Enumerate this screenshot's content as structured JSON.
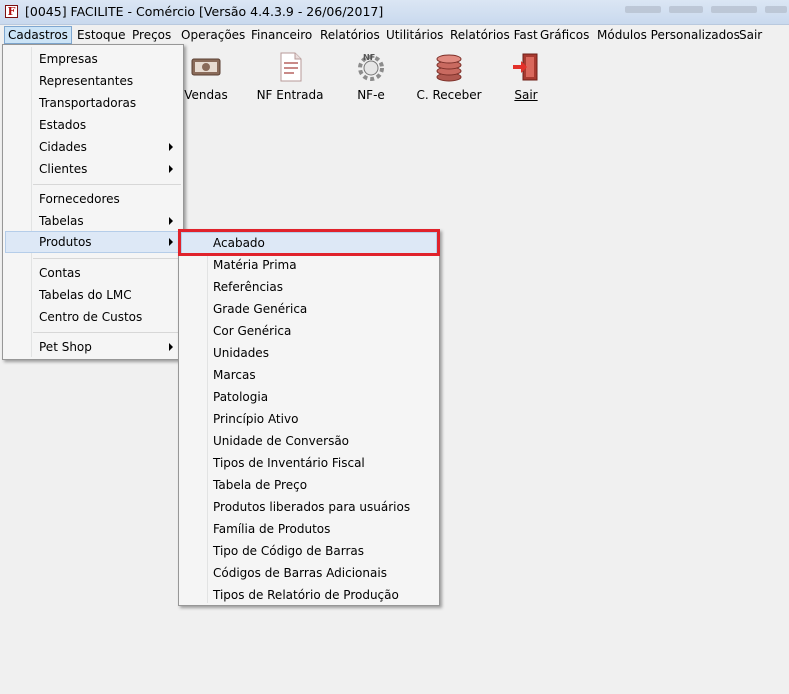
{
  "window": {
    "title": "[0045] FACILITE - Comércio [Versão 4.4.3.9 - 26/06/2017]",
    "app_icon_glyph": "F"
  },
  "menubar": [
    "Cadastros",
    "Estoque",
    "Preços",
    "Operações",
    "Financeiro",
    "Relatórios",
    "Utilitários",
    "Relatórios Fast",
    "Gráficos",
    "Módulos Personalizados",
    "Sair"
  ],
  "toolbar": {
    "vendas": "Vendas",
    "nf_entrada": "NF Entrada",
    "nfe": "NF-e",
    "c_receber": "C. Receber",
    "sair": "Sair"
  },
  "cadastros_menu": {
    "empresas": "Empresas",
    "representantes": "Representantes",
    "transportadoras": "Transportadoras",
    "estados": "Estados",
    "cidades": "Cidades",
    "clientes": "Clientes",
    "fornecedores": "Fornecedores",
    "tabelas": "Tabelas",
    "produtos": "Produtos",
    "contas": "Contas",
    "tabelas_lmc": "Tabelas do LMC",
    "centro_custos": "Centro de Custos",
    "pet_shop": "Pet Shop"
  },
  "produtos_menu": [
    "Acabado",
    "Matéria Prima",
    "Referências",
    "Grade Genérica",
    "Cor Genérica",
    "Unidades",
    "Marcas",
    "Patologia",
    "Princípio Ativo",
    "Unidade de Conversão",
    "Tipos de Inventário Fiscal",
    "Tabela de Preço",
    "Produtos liberados para usuários",
    "Família de Produtos",
    "Tipo de Código de Barras",
    "Códigos de Barras Adicionais",
    "Tipos de Relatório de Produção"
  ],
  "colors": {
    "highlight_box": "#e0222b",
    "menu_hover": "#dde8f6",
    "menubar_active": "#cce4f7"
  }
}
